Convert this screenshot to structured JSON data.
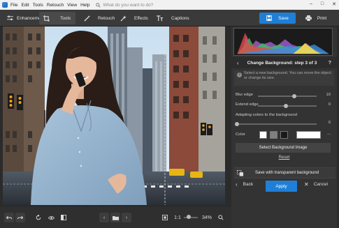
{
  "menubar": {
    "items": [
      "File",
      "Edit",
      "Tools",
      "Retouch",
      "View",
      "Help"
    ],
    "search_placeholder": "What do you want to do?",
    "window_controls": [
      "–",
      "□",
      "✕"
    ]
  },
  "toolbar": {
    "tabs": [
      {
        "label": "Enhancement",
        "icon": "sliders-icon"
      },
      {
        "label": "Tools",
        "icon": "crop-icon",
        "active": true
      },
      {
        "label": "Retouch",
        "icon": "brush-icon"
      },
      {
        "label": "Effects",
        "icon": "magic-wand-icon"
      },
      {
        "label": "Captions",
        "icon": "text-icon"
      }
    ],
    "save_label": "Save",
    "print_label": "Print"
  },
  "panel": {
    "step_title": "Change Background: step 3 of 3",
    "help": "?",
    "info_text": "Select a new background. You can move the object or change its size.",
    "blur_edge": {
      "label": "Blur edge",
      "value": "10",
      "fraction": 0.62
    },
    "extend_edge": {
      "label": "Extend edge",
      "value": "0",
      "fraction": 0.48
    },
    "adapting": {
      "label": "Adapting colors to the background",
      "value": "0",
      "fraction": 0.0
    },
    "color": {
      "label": "Color",
      "swatches": [
        "#ffffff",
        "#808080",
        "#1a1a1a"
      ],
      "selected_color": "#ffffff",
      "more": "..."
    },
    "select_bg_label": "Select Background Image",
    "reset_label": "Reset",
    "save_transparent_label": "Save with transparent background",
    "back_label": "Back",
    "apply_label": "Apply",
    "cancel_label": "Cancel"
  },
  "bottombar": {
    "ratio_label": "1:1",
    "zoom_value": "34%"
  },
  "colors": {
    "accent": "#1f7fd6",
    "panel_bg": "#333333",
    "toolbar_bg": "#3a3a3a"
  }
}
